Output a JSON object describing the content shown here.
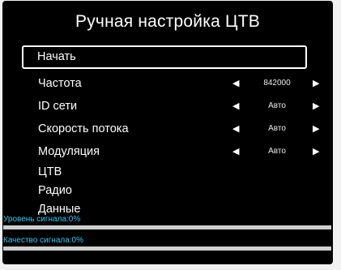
{
  "title": "Ручная настройка ЦТВ",
  "menu": {
    "start": "Начать",
    "frequency": {
      "label": "Частота",
      "value": "842000"
    },
    "network_id": {
      "label": "ID сети",
      "value": "Авто"
    },
    "bitrate": {
      "label": "Скорость потока",
      "value": "Авто"
    },
    "modulation": {
      "label": "Модуляция",
      "value": "Авто"
    },
    "dtv": "ЦТВ",
    "radio": "Радио",
    "data": "Данные"
  },
  "arrows": {
    "left": "◀",
    "right": "▶"
  },
  "signal": {
    "level_label": "Уровень сигнала:0%",
    "level_value": 0,
    "quality_label": "Качество сигнала:0%",
    "quality_value": 0
  },
  "colors": {
    "background": "#000000",
    "text": "#ffffff",
    "signal_label": "#35c4f0",
    "bar_track": "#cfcfcf"
  }
}
